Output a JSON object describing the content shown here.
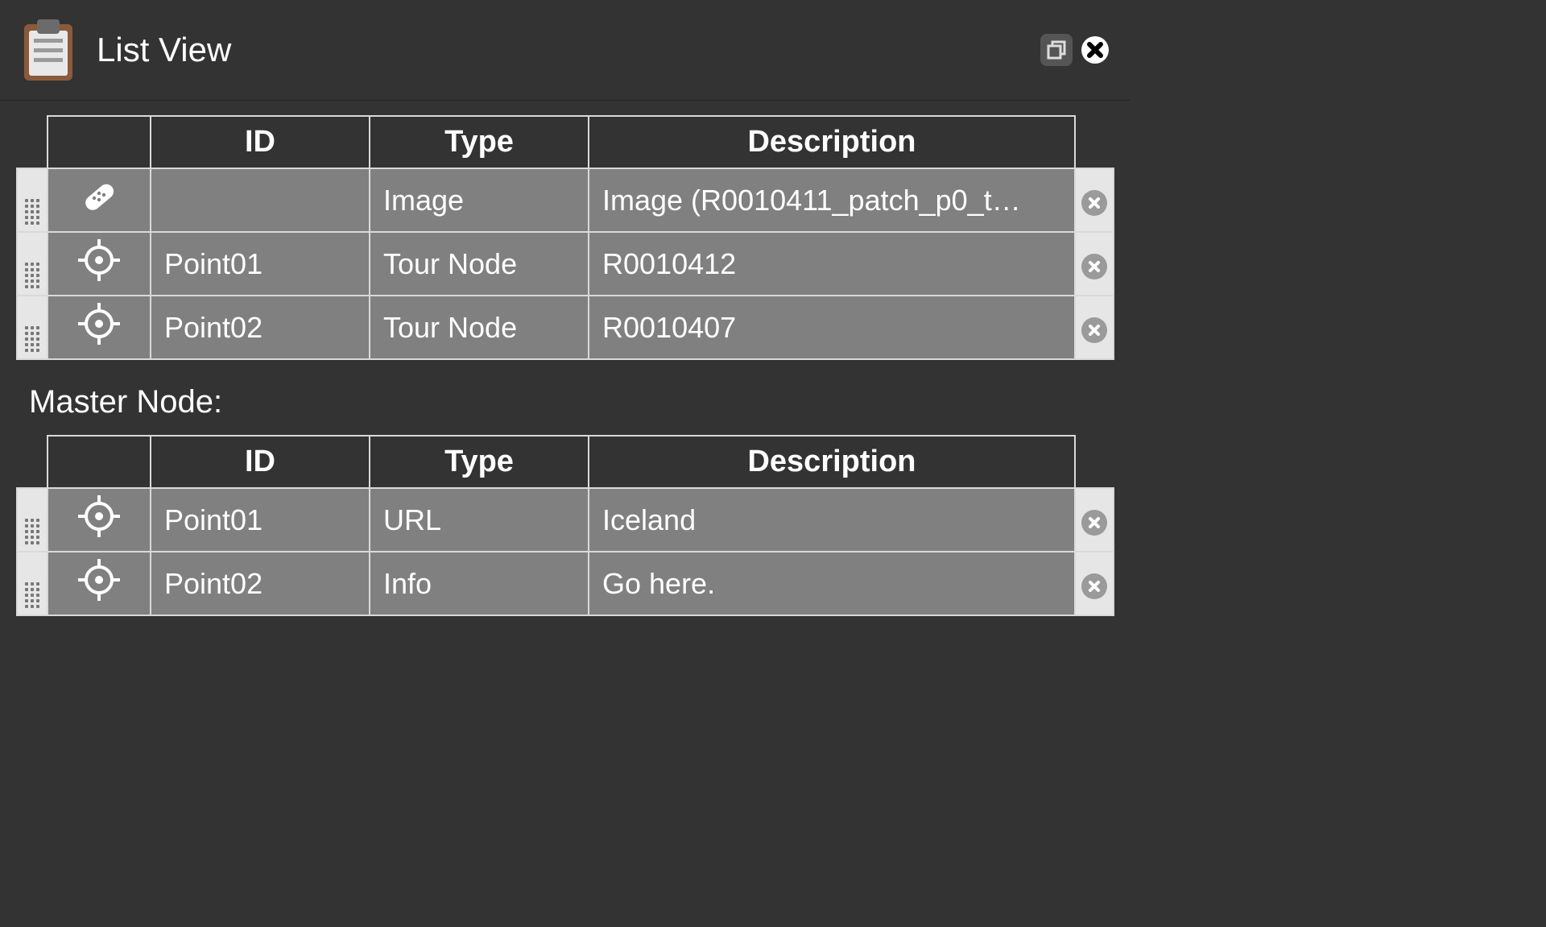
{
  "title": "List View",
  "columns": {
    "id": "ID",
    "type": "Type",
    "description": "Description"
  },
  "section_label": "Master Node:",
  "table1": {
    "rows": [
      {
        "icon": "patch",
        "id": "",
        "type": "Image",
        "description": "Image (R0010411_patch_p0_t…"
      },
      {
        "icon": "target",
        "id": "Point01",
        "type": "Tour Node",
        "description": "R0010412"
      },
      {
        "icon": "target",
        "id": "Point02",
        "type": "Tour Node",
        "description": "R0010407"
      }
    ]
  },
  "table2": {
    "rows": [
      {
        "icon": "target",
        "id": "Point01",
        "type": "URL",
        "description": "Iceland"
      },
      {
        "icon": "target",
        "id": "Point02",
        "type": "Info",
        "description": "Go here."
      }
    ]
  }
}
